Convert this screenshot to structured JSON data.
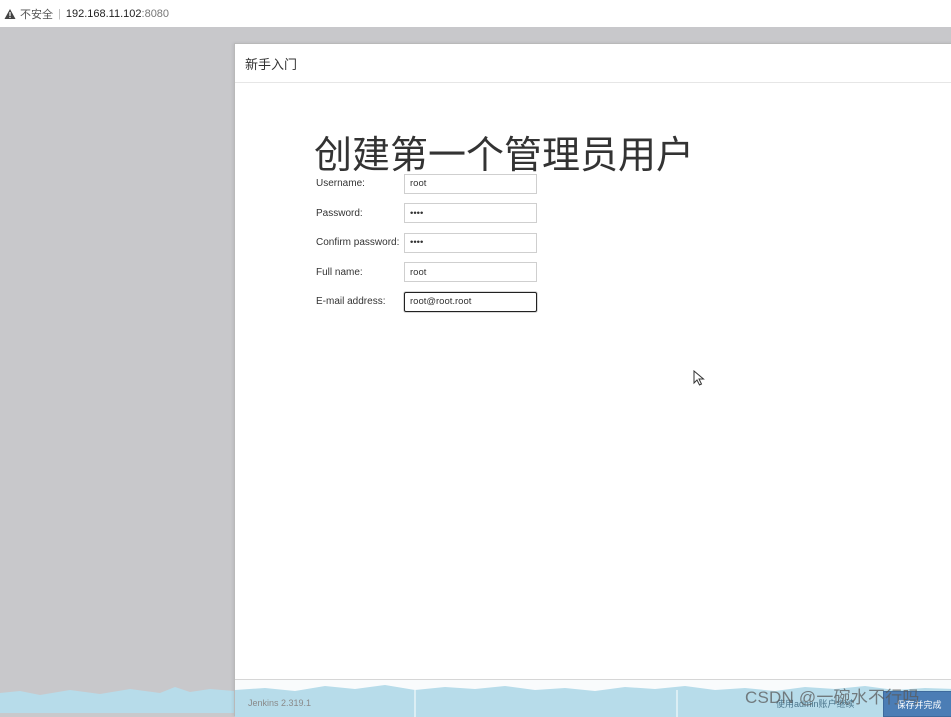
{
  "browser": {
    "security_label": "不安全",
    "url_host": "192.168.11.102",
    "url_port": ":8080"
  },
  "dialog": {
    "header_title": "新手入门",
    "page_title": "创建第一个管理员用户"
  },
  "form": {
    "fields": [
      {
        "label": "Username:",
        "value": "root",
        "type": "text"
      },
      {
        "label": "Password:",
        "value": "root",
        "type": "password"
      },
      {
        "label": "Confirm password:",
        "value": "root",
        "type": "password"
      },
      {
        "label": "Full name:",
        "value": "root",
        "type": "text"
      },
      {
        "label": "E-mail address:",
        "value": "root@root.root",
        "type": "text"
      }
    ]
  },
  "footer": {
    "version": "Jenkins 2.319.1",
    "skip_label": "使用admin账户继续",
    "save_label": "保存并完成"
  },
  "watermark": "CSDN @一碗水不行吗",
  "colors": {
    "primary_button": "#4b7db5",
    "wave": "#b7dcea"
  }
}
